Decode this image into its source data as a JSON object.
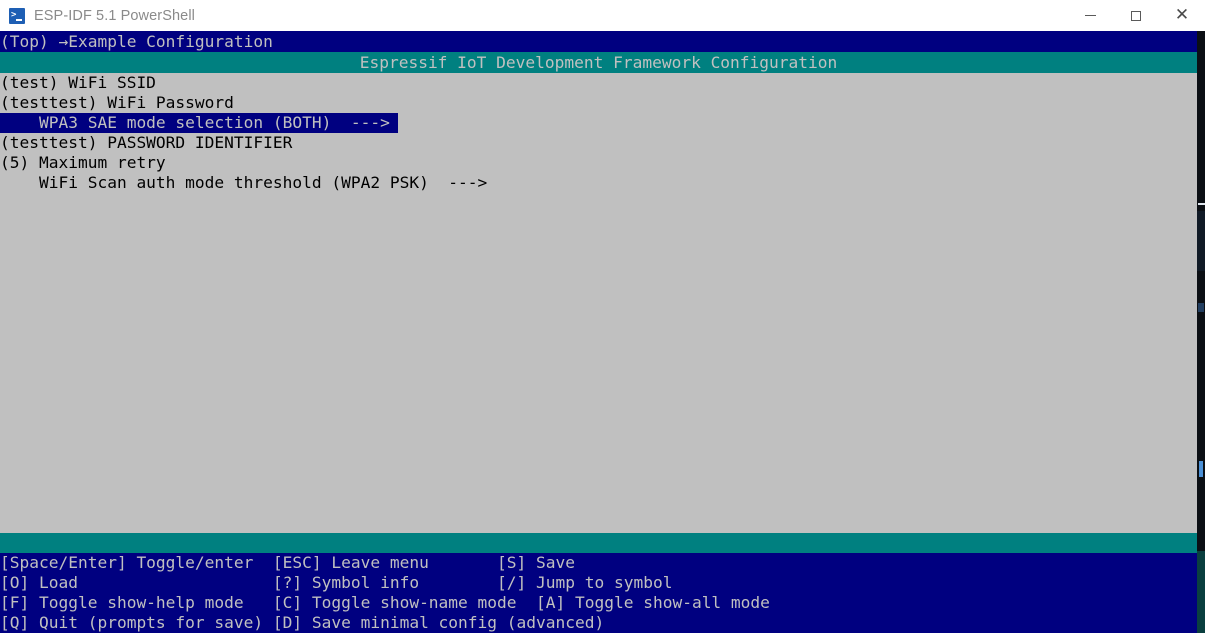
{
  "window": {
    "title": "ESP-IDF 5.1 PowerShell",
    "app_icon": "powershell-icon",
    "buttons": {
      "minimize": "minimize-icon",
      "maximize": "maximize-icon",
      "close": "close-icon"
    }
  },
  "colors": {
    "terminal_background": "#c0c0c0",
    "bar_navy": "#000080",
    "bar_teal": "#008080",
    "text_dark": "#000000",
    "text_light": "#c0c0c0",
    "titlebar_background": "#ffffff",
    "titlebar_text": "#8a8a8a"
  },
  "breadcrumb": {
    "text": "(Top) →Example Configuration"
  },
  "app_header": {
    "title": "Espressif IoT Development Framework Configuration"
  },
  "menu": {
    "selected_index": 2,
    "items": [
      {
        "text": "(test) WiFi SSID",
        "selected": false
      },
      {
        "text": "(testtest) WiFi Password",
        "selected": false
      },
      {
        "text": "    WPA3 SAE mode selection (BOTH)  --->",
        "selected": true
      },
      {
        "text": "(testtest) PASSWORD IDENTIFIER",
        "selected": false
      },
      {
        "text": "(5) Maximum retry",
        "selected": false
      },
      {
        "text": "    WiFi Scan auth mode threshold (WPA2 PSK)  --->",
        "selected": false
      }
    ]
  },
  "footer": {
    "rows": [
      "[Space/Enter] Toggle/enter  [ESC] Leave menu       [S] Save",
      "[O] Load                    [?] Symbol info        [/] Jump to symbol",
      "[F] Toggle show-help mode   [C] Toggle show-name mode  [A] Toggle show-all mode",
      "[Q] Quit (prompts for save) [D] Save minimal config (advanced)"
    ]
  }
}
